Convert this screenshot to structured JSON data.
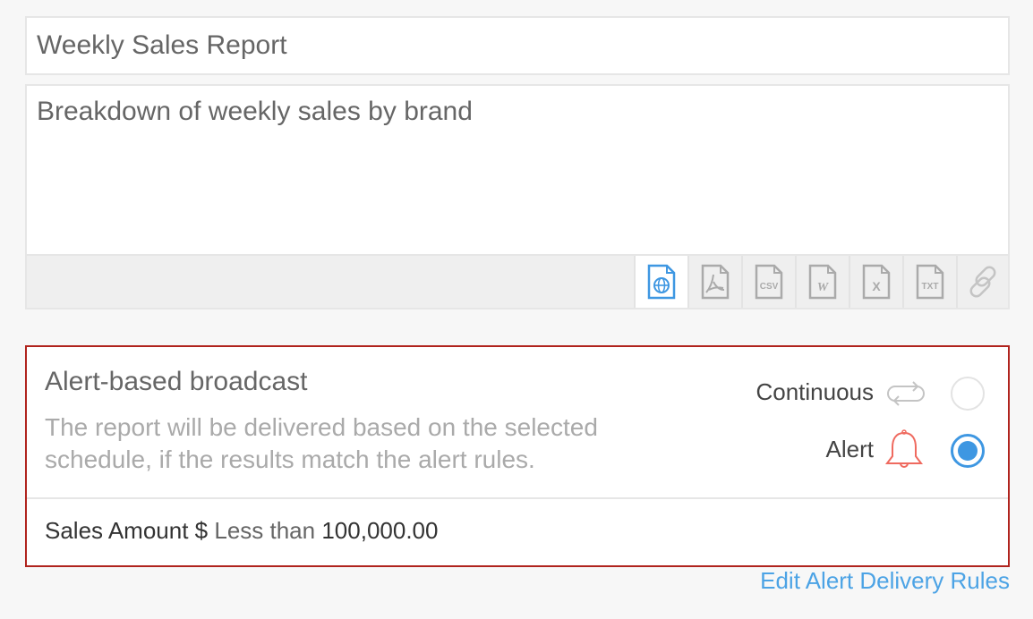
{
  "report": {
    "title": "Weekly Sales Report",
    "description": "Breakdown of weekly sales by brand"
  },
  "formats": [
    {
      "name": "web",
      "label": "Web",
      "active": true
    },
    {
      "name": "pdf",
      "label": "PDF",
      "active": false
    },
    {
      "name": "csv",
      "label": "CSV",
      "active": false
    },
    {
      "name": "word",
      "label": "W",
      "active": false
    },
    {
      "name": "excel",
      "label": "X",
      "active": false
    },
    {
      "name": "txt",
      "label": "TXT",
      "active": false
    },
    {
      "name": "link",
      "label": "Link",
      "active": false
    }
  ],
  "alert": {
    "title": "Alert-based broadcast",
    "description": "The report will be delivered based on the selected schedule, if the results match the alert rules.",
    "options": [
      {
        "label": "Continuous",
        "icon": "repeat-icon",
        "selected": false
      },
      {
        "label": "Alert",
        "icon": "bell-icon",
        "selected": true
      }
    ],
    "rule": {
      "field": "Sales Amount $",
      "operator": "Less than",
      "value": "100,000.00"
    },
    "border_color": "#b0231d"
  },
  "edit_link": "Edit Alert Delivery Rules",
  "colors": {
    "accent": "#3e97e2",
    "link": "#4ca3e5",
    "bell": "#ef6a5f"
  }
}
